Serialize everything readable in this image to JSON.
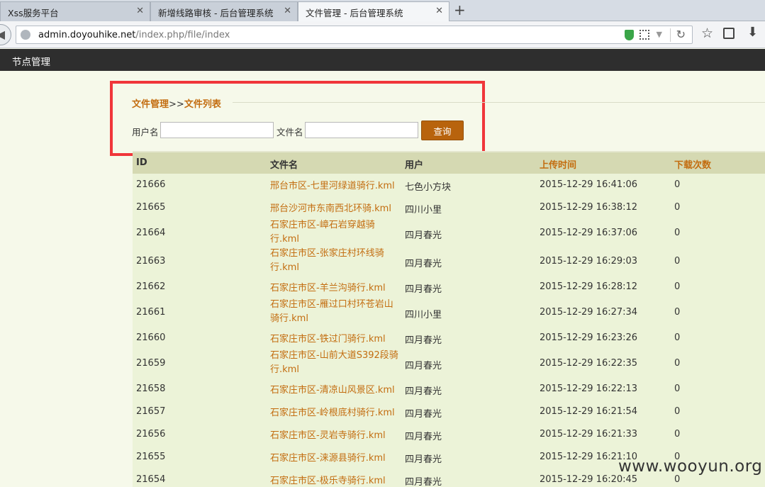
{
  "browser": {
    "tabs": [
      {
        "title": "Xss服务平台",
        "active": false
      },
      {
        "title": "新增线路审核 - 后台管理系统",
        "active": false
      },
      {
        "title": "文件管理 - 后台管理系统",
        "active": true
      }
    ],
    "new_tab": "+",
    "url_host": "admin.doyouhike.net",
    "url_path": "/index.php/file/index"
  },
  "top_menu": {
    "item": "节点管理"
  },
  "breadcrumb": {
    "root": "文件管理",
    "sep": ">>",
    "current": "文件列表"
  },
  "search": {
    "username_label": "用户名",
    "filename_label": "文件名",
    "username_value": "",
    "filename_value": "",
    "button": "查询"
  },
  "table": {
    "headers": [
      "ID",
      "文件名",
      "用户",
      "上传时间",
      "下载次数"
    ],
    "rows": [
      {
        "id": "21666",
        "file": "邢台市区-七里河绿道骑行.kml",
        "user": "七色小方块",
        "time": "2015-12-29 16:41:06",
        "downloads": "0"
      },
      {
        "id": "21665",
        "file": "邢台沙河市东南西北环骑.kml",
        "user": "四川小里",
        "time": "2015-12-29 16:38:12",
        "downloads": "0"
      },
      {
        "id": "21664",
        "file": "石家庄市区-嶂石岩穿越骑行.kml",
        "user": "四月春光",
        "time": "2015-12-29 16:37:06",
        "downloads": "0"
      },
      {
        "id": "21663",
        "file": "石家庄市区-张家庄村环线骑行.kml",
        "user": "四月春光",
        "time": "2015-12-29 16:29:03",
        "downloads": "0"
      },
      {
        "id": "21662",
        "file": "石家庄市区-羊兰沟骑行.kml",
        "user": "四月春光",
        "time": "2015-12-29 16:28:12",
        "downloads": "0"
      },
      {
        "id": "21661",
        "file": "石家庄市区-雁过口村环苍岩山骑行.kml",
        "user": "四川小里",
        "time": "2015-12-29 16:27:34",
        "downloads": "0"
      },
      {
        "id": "21660",
        "file": "石家庄市区-铁过门骑行.kml",
        "user": "四月春光",
        "time": "2015-12-29 16:23:26",
        "downloads": "0"
      },
      {
        "id": "21659",
        "file": "石家庄市区-山前大道S392段骑行.kml",
        "user": "四月春光",
        "time": "2015-12-29 16:22:35",
        "downloads": "0"
      },
      {
        "id": "21658",
        "file": "石家庄市区-清凉山风景区.kml",
        "user": "四月春光",
        "time": "2015-12-29 16:22:13",
        "downloads": "0"
      },
      {
        "id": "21657",
        "file": "石家庄市区-岭根底村骑行.kml",
        "user": "四月春光",
        "time": "2015-12-29 16:21:54",
        "downloads": "0"
      },
      {
        "id": "21656",
        "file": "石家庄市区-灵岩寺骑行.kml",
        "user": "四月春光",
        "time": "2015-12-29 16:21:33",
        "downloads": "0"
      },
      {
        "id": "21655",
        "file": "石家庄市区-涞源县骑行.kml",
        "user": "四月春光",
        "time": "2015-12-29 16:21:10",
        "downloads": "0"
      },
      {
        "id": "21654",
        "file": "石家庄市区-极乐寺骑行.kml",
        "user": "四月春光",
        "time": "2015-12-29 16:20:45",
        "downloads": "0"
      }
    ]
  },
  "watermark": "www.wooyun.org"
}
